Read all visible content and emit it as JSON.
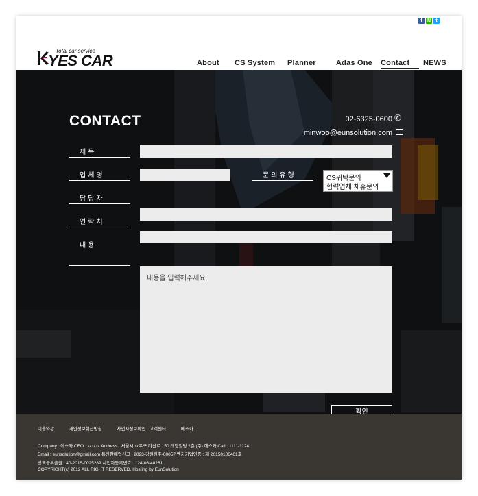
{
  "social": [
    "f",
    "N",
    "t"
  ],
  "logo": {
    "tagline": "Total car service",
    "name": "YES CAR"
  },
  "nav": [
    {
      "label": "About"
    },
    {
      "label": "CS System"
    },
    {
      "label": "Planner"
    },
    {
      "label": "Adas One"
    },
    {
      "label": "Contact"
    },
    {
      "label": "NEWS"
    }
  ],
  "contact": {
    "title": "CONTACT",
    "phone": "02-6325-0600",
    "email": "minwoo@eunsolution.com"
  },
  "form": {
    "subject_label": "제목",
    "company_label": "업체명",
    "inquiry_type_label": "문의유형",
    "contact_person_label": "담당자",
    "phone_label": "연락처",
    "content_label": "내용",
    "content_placeholder": "내용을 입력해주세요.",
    "inquiry_selected": "CS위탁문의",
    "inquiry_option": "협력업체 체휴문의",
    "submit_label": "확인"
  },
  "footer": {
    "links": [
      "이용약관",
      "개인정보취급방침",
      "사업자정보확인",
      "고객센터",
      "에스카"
    ],
    "line1": "Company : 에스카      CEO : ㅇㅇㅇ      Address : 서울시 ㅇ우구 다산로 150 태양빌딩 2층 (주) 에스카      Call : 1111-1124",
    "line2": "Email : eunsolution@gmail.com     통신판매업신고 : 2023-강원원주-00057 벤처기업인증 : 제 20150106461호",
    "line3": "상표등록출원 : 40-2015-0025289          사업자등록번호 : 124-06-48261",
    "line4": "COPYRIGHT(c) 2012 ALL RIGHT RESERVED. Hosting by EunSolution"
  }
}
